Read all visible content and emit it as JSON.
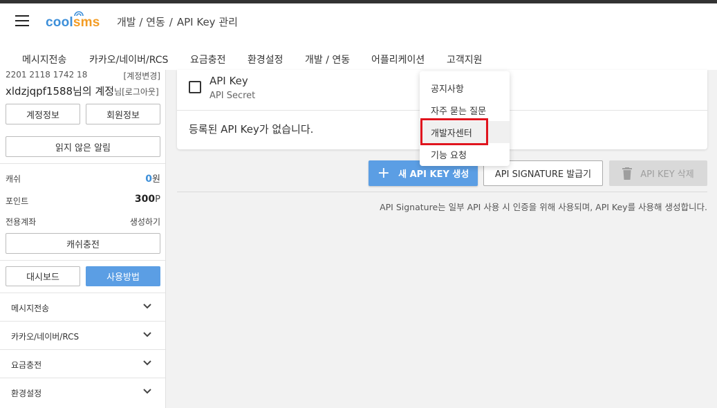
{
  "header": {
    "logo": {
      "part1": "cool",
      "part2": "sms",
      "brand_blue": "#3d8fd9",
      "brand_orange": "#f39c24"
    },
    "breadcrumb": [
      "개발 / 연동",
      "/",
      "API Key 관리"
    ],
    "menu_icon": "hamburger-menu-icon"
  },
  "topnav": {
    "items": [
      "메시지전송",
      "카카오/네이버/RCS",
      "요금충전",
      "환경설정",
      "개발 / 연동",
      "어플리케이션",
      "고객지원"
    ]
  },
  "sidebar": {
    "meta_left": "2201 2118 1742 18",
    "meta_right": "[계정변경]",
    "account_name": "xldzjqpf1588님의 계정",
    "account_suffix": "님[로그아웃]",
    "buttons": {
      "account_info": "계정정보",
      "member_info": "회원정보",
      "unread_alerts": "읽지 않은 알림",
      "charge_cash": "캐쉬충전",
      "dashboard": "대시보드",
      "how_to": "사용방법"
    },
    "cash": {
      "label": "캐쉬",
      "value": "0",
      "unit": "원"
    },
    "point": {
      "label": "포인트",
      "value": "300",
      "unit": "P"
    },
    "account_transfer": {
      "label": "전용계좌",
      "action": "생성하기"
    },
    "accordion": [
      "메시지전송",
      "카카오/네이버/RCS",
      "요금충전",
      "환경설정"
    ]
  },
  "main": {
    "table": {
      "col_title": "API Key",
      "col_sub": "API Secret",
      "empty_message": "등록된 API Key가 없습니다."
    },
    "actions": {
      "new_key": "새 API KEY 생성",
      "signature": "API SIGNATURE 발급기",
      "delete_key": "API KEY 삭제"
    },
    "note": "API Signature는 일부 API 사용 시 인증을 위해 사용되며, API Key를 사용해 생성합니다."
  },
  "dropdown": {
    "items": [
      "공지사항",
      "자주 묻는 질문",
      "개발자센터",
      "기능 요청"
    ],
    "highlighted_index": 2,
    "highlight_color": "#e0141e"
  },
  "colors": {
    "primary": "#5b9ee4",
    "disabled": "#d9d9d9"
  }
}
